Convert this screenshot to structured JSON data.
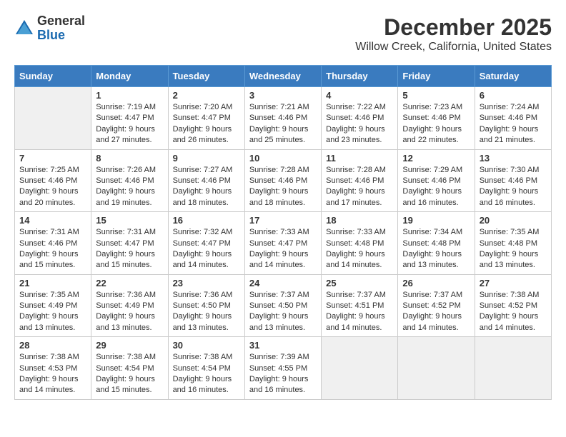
{
  "logo": {
    "general": "General",
    "blue": "Blue"
  },
  "title": "December 2025",
  "location": "Willow Creek, California, United States",
  "days_of_week": [
    "Sunday",
    "Monday",
    "Tuesday",
    "Wednesday",
    "Thursday",
    "Friday",
    "Saturday"
  ],
  "weeks": [
    [
      {
        "num": "",
        "info": ""
      },
      {
        "num": "1",
        "info": "Sunrise: 7:19 AM\nSunset: 4:47 PM\nDaylight: 9 hours\nand 27 minutes."
      },
      {
        "num": "2",
        "info": "Sunrise: 7:20 AM\nSunset: 4:47 PM\nDaylight: 9 hours\nand 26 minutes."
      },
      {
        "num": "3",
        "info": "Sunrise: 7:21 AM\nSunset: 4:46 PM\nDaylight: 9 hours\nand 25 minutes."
      },
      {
        "num": "4",
        "info": "Sunrise: 7:22 AM\nSunset: 4:46 PM\nDaylight: 9 hours\nand 23 minutes."
      },
      {
        "num": "5",
        "info": "Sunrise: 7:23 AM\nSunset: 4:46 PM\nDaylight: 9 hours\nand 22 minutes."
      },
      {
        "num": "6",
        "info": "Sunrise: 7:24 AM\nSunset: 4:46 PM\nDaylight: 9 hours\nand 21 minutes."
      }
    ],
    [
      {
        "num": "7",
        "info": "Sunrise: 7:25 AM\nSunset: 4:46 PM\nDaylight: 9 hours\nand 20 minutes."
      },
      {
        "num": "8",
        "info": "Sunrise: 7:26 AM\nSunset: 4:46 PM\nDaylight: 9 hours\nand 19 minutes."
      },
      {
        "num": "9",
        "info": "Sunrise: 7:27 AM\nSunset: 4:46 PM\nDaylight: 9 hours\nand 18 minutes."
      },
      {
        "num": "10",
        "info": "Sunrise: 7:28 AM\nSunset: 4:46 PM\nDaylight: 9 hours\nand 18 minutes."
      },
      {
        "num": "11",
        "info": "Sunrise: 7:28 AM\nSunset: 4:46 PM\nDaylight: 9 hours\nand 17 minutes."
      },
      {
        "num": "12",
        "info": "Sunrise: 7:29 AM\nSunset: 4:46 PM\nDaylight: 9 hours\nand 16 minutes."
      },
      {
        "num": "13",
        "info": "Sunrise: 7:30 AM\nSunset: 4:46 PM\nDaylight: 9 hours\nand 16 minutes."
      }
    ],
    [
      {
        "num": "14",
        "info": "Sunrise: 7:31 AM\nSunset: 4:46 PM\nDaylight: 9 hours\nand 15 minutes."
      },
      {
        "num": "15",
        "info": "Sunrise: 7:31 AM\nSunset: 4:47 PM\nDaylight: 9 hours\nand 15 minutes."
      },
      {
        "num": "16",
        "info": "Sunrise: 7:32 AM\nSunset: 4:47 PM\nDaylight: 9 hours\nand 14 minutes."
      },
      {
        "num": "17",
        "info": "Sunrise: 7:33 AM\nSunset: 4:47 PM\nDaylight: 9 hours\nand 14 minutes."
      },
      {
        "num": "18",
        "info": "Sunrise: 7:33 AM\nSunset: 4:48 PM\nDaylight: 9 hours\nand 14 minutes."
      },
      {
        "num": "19",
        "info": "Sunrise: 7:34 AM\nSunset: 4:48 PM\nDaylight: 9 hours\nand 13 minutes."
      },
      {
        "num": "20",
        "info": "Sunrise: 7:35 AM\nSunset: 4:48 PM\nDaylight: 9 hours\nand 13 minutes."
      }
    ],
    [
      {
        "num": "21",
        "info": "Sunrise: 7:35 AM\nSunset: 4:49 PM\nDaylight: 9 hours\nand 13 minutes."
      },
      {
        "num": "22",
        "info": "Sunrise: 7:36 AM\nSunset: 4:49 PM\nDaylight: 9 hours\nand 13 minutes."
      },
      {
        "num": "23",
        "info": "Sunrise: 7:36 AM\nSunset: 4:50 PM\nDaylight: 9 hours\nand 13 minutes."
      },
      {
        "num": "24",
        "info": "Sunrise: 7:37 AM\nSunset: 4:50 PM\nDaylight: 9 hours\nand 13 minutes."
      },
      {
        "num": "25",
        "info": "Sunrise: 7:37 AM\nSunset: 4:51 PM\nDaylight: 9 hours\nand 14 minutes."
      },
      {
        "num": "26",
        "info": "Sunrise: 7:37 AM\nSunset: 4:52 PM\nDaylight: 9 hours\nand 14 minutes."
      },
      {
        "num": "27",
        "info": "Sunrise: 7:38 AM\nSunset: 4:52 PM\nDaylight: 9 hours\nand 14 minutes."
      }
    ],
    [
      {
        "num": "28",
        "info": "Sunrise: 7:38 AM\nSunset: 4:53 PM\nDaylight: 9 hours\nand 14 minutes."
      },
      {
        "num": "29",
        "info": "Sunrise: 7:38 AM\nSunset: 4:54 PM\nDaylight: 9 hours\nand 15 minutes."
      },
      {
        "num": "30",
        "info": "Sunrise: 7:38 AM\nSunset: 4:54 PM\nDaylight: 9 hours\nand 16 minutes."
      },
      {
        "num": "31",
        "info": "Sunrise: 7:39 AM\nSunset: 4:55 PM\nDaylight: 9 hours\nand 16 minutes."
      },
      {
        "num": "",
        "info": ""
      },
      {
        "num": "",
        "info": ""
      },
      {
        "num": "",
        "info": ""
      }
    ]
  ]
}
